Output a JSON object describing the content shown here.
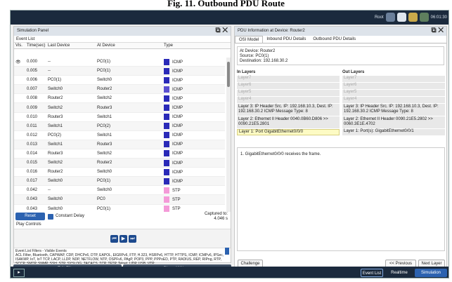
{
  "caption": "Fig. 11. Outbound PDU Route",
  "topbar": {
    "clock": "06:01:30",
    "user_label": "Root"
  },
  "sim_panel": {
    "title": "Simulation Panel",
    "event_list_label": "Event List",
    "columns": [
      "Vis.",
      "Time(sec)",
      "Last Device",
      "At Device",
      "Type"
    ],
    "events": [
      {
        "vis": "eye",
        "time": "0.000",
        "last": "--",
        "at": "PC0(1)",
        "type": "ICMP",
        "color": "#2a2ab8"
      },
      {
        "vis": "",
        "time": "0.005",
        "last": "--",
        "at": "PC0(1)",
        "type": "ICMP",
        "color": "#2a2ab8"
      },
      {
        "vis": "",
        "time": "0.006",
        "last": "PC0(1)",
        "at": "Switch0",
        "type": "ICMP",
        "color": "#2a2ab8"
      },
      {
        "vis": "",
        "time": "0.007",
        "last": "Switch0",
        "at": "Router2",
        "type": "ICMP",
        "color": "#5a4fd0"
      },
      {
        "vis": "",
        "time": "0.008",
        "last": "Router2",
        "at": "Switch2",
        "type": "ICMP",
        "color": "#2a2ab8"
      },
      {
        "vis": "",
        "time": "0.009",
        "last": "Switch2",
        "at": "Router3",
        "type": "ICMP",
        "color": "#2a2ab8"
      },
      {
        "vis": "",
        "time": "0.010",
        "last": "Router3",
        "at": "Switch1",
        "type": "ICMP",
        "color": "#2a2ab8"
      },
      {
        "vis": "",
        "time": "0.011",
        "last": "Switch1",
        "at": "PC0(2)",
        "type": "ICMP",
        "color": "#2a2ab8"
      },
      {
        "vis": "",
        "time": "0.012",
        "last": "PC0(2)",
        "at": "Switch1",
        "type": "ICMP",
        "color": "#2a2ab8"
      },
      {
        "vis": "",
        "time": "0.013",
        "last": "Switch1",
        "at": "Router3",
        "type": "ICMP",
        "color": "#2a2ab8"
      },
      {
        "vis": "",
        "time": "0.014",
        "last": "Router3",
        "at": "Switch2",
        "type": "ICMP",
        "color": "#2a2ab8"
      },
      {
        "vis": "",
        "time": "0.015",
        "last": "Switch2",
        "at": "Router2",
        "type": "ICMP",
        "color": "#2a2ab8"
      },
      {
        "vis": "",
        "time": "0.016",
        "last": "Router2",
        "at": "Switch0",
        "type": "ICMP",
        "color": "#2a2ab8"
      },
      {
        "vis": "",
        "time": "0.017",
        "last": "Switch0",
        "at": "PC0(1)",
        "type": "ICMP",
        "color": "#2a2ab8"
      },
      {
        "vis": "",
        "time": "0.042",
        "last": "--",
        "at": "Switch0",
        "type": "STP",
        "color": "#f49ad8"
      },
      {
        "vis": "",
        "time": "0.043",
        "last": "Switch0",
        "at": "PC0",
        "type": "STP",
        "color": "#f49ad8"
      },
      {
        "vis": "",
        "time": "0.043",
        "last": "Switch0",
        "at": "PC0(1)",
        "type": "STP",
        "color": "#f49ad8"
      }
    ],
    "reset_label": "Reset Simulation",
    "constant_delay_label": "Constant Delay",
    "captured_label": "Captured to:",
    "captured_value": "4.046 s",
    "play_controls_label": "Play Controls",
    "filters_label": "Event List Filters - Visible Events",
    "filters_text": "ACL Filter, Bluetooth, CAPWAP, CDP, DHCPv6, DTP, EAPOL, EIGRPv6, FTP, H.323, HSRPv6, HTTP, HTTPS, ICMP, ICMPv6, IPSec, ISAKMP, IoT, IoT TCP, LACP, LLDP, NDP, NETFLOW, NTP, OSPFv6, PAgP, POP3, PPP, PPPoED, PTP, RADIUS, REP, RIPng, RTP, SCCP, SMTP, SNMP, SSH, STP, SYSLOG, TACACS, TCP, TFTP, Telnet, UDP, USB, VTP",
    "edit_filters_label": "Edit Filters",
    "show_all_label": "Show All/None"
  },
  "pdu_panel": {
    "title": "PDU Information at Device: Router2",
    "tabs": [
      "OSI Model",
      "Inbound PDU Details",
      "Outbound PDU Details"
    ],
    "at_device": "At Device: Router2",
    "source": "Source: PC0(1)",
    "destination": "Destination: 192.168.30.2",
    "in_layers_label": "In Layers",
    "out_layers_label": "Out Layers",
    "in_layers": [
      "Layer7",
      "Layer6",
      "Layer5",
      "Layer4",
      "Layer 3: IP Header Src. IP: 192.168.10.3, Dest. IP: 192.168.30.2 ICMP Message Type: 8",
      "Layer 2: Ethernet II Header 0040.0B60.D806 >> 0090.21E5.2801",
      "Layer 1: Port GigabitEthernet0/0/0"
    ],
    "out_layers": [
      "Layer7",
      "Layer6",
      "Layer5",
      "Layer4",
      "Layer 3: IP Header Src. IP: 192.168.10.3, Dest. IP: 192.168.30.2 ICMP Message Type: 8",
      "Layer 2: Ethernet II Header 0090.21E5.2802 >> 0060.3E1E.4702",
      "Layer 1: Port(s): GigabitEthernet0/0/1"
    ],
    "detail_text": "1. GigabitEthernet0/0/0 receives the frame.",
    "challenge_label": "Challenge Me",
    "prev_layer_label": "<< Previous Layer",
    "next_layer_label": "Next Layer >>"
  },
  "bottombar": {
    "event_list_label": "Event List",
    "realtime_label": "Realtime",
    "simulation_label": "Simulation"
  },
  "colors": {
    "accent": "#2c62b0",
    "icmp": "#2a2ab8",
    "stp": "#f49ad8",
    "dark": "#1b2a3d"
  }
}
